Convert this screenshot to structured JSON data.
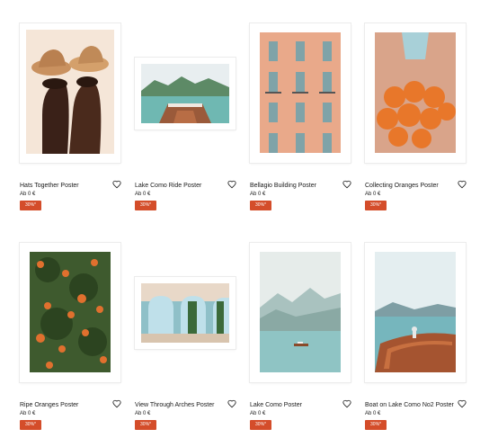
{
  "products": [
    {
      "name": "Hats Together Poster",
      "price": "Ab 0 €",
      "badge": "30%*",
      "icon": "heart-icon"
    },
    {
      "name": "Lake Como Ride Poster",
      "price": "Ab 0 €",
      "badge": "30%*",
      "icon": "heart-icon"
    },
    {
      "name": "Bellagio Building Poster",
      "price": "Ab 0 €",
      "badge": "30%*",
      "icon": "heart-icon"
    },
    {
      "name": "Collecting Oranges Poster",
      "price": "Ab 0 €",
      "badge": "30%*",
      "icon": "heart-icon"
    },
    {
      "name": "Ripe Oranges Poster",
      "price": "Ab 0 €",
      "badge": "30%*",
      "icon": "heart-icon"
    },
    {
      "name": "View Through Arches Poster",
      "price": "Ab 0 €",
      "badge": "30%*",
      "icon": "heart-icon"
    },
    {
      "name": "Lake Como Poster",
      "price": "Ab 0 €",
      "badge": "30%*",
      "icon": "heart-icon"
    },
    {
      "name": "Boat on Lake Como No2 Poster",
      "price": "Ab 0 €",
      "badge": "30%*",
      "icon": "heart-icon"
    }
  ],
  "colors": {
    "badge": "#d44d2a",
    "text": "#1a1a1a"
  }
}
